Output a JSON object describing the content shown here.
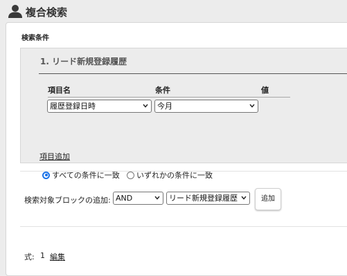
{
  "header": {
    "title": "複合検索",
    "icon": "person-icon"
  },
  "panel": {
    "label": "検索条件"
  },
  "block": {
    "title": "1. リード新規登録履歴",
    "columns": {
      "item": "項目名",
      "condition": "条件",
      "value": "値"
    },
    "row": {
      "item_select": "履歴登録日時",
      "condition_select": "今月"
    },
    "add_item_link": "項目追加",
    "match_options": {
      "all": "すべての条件に一致",
      "any": "いずれかの条件に一致",
      "selected": "all"
    }
  },
  "block_add": {
    "label": "検索対象ブロックの追加:",
    "operator_select": "AND",
    "target_select": "リード新規登録履歴",
    "button": "追加"
  },
  "formula": {
    "label": "式:",
    "value": "1",
    "edit_link": "編集"
  },
  "colors": {
    "accent": "#1a73e8",
    "panel_bg": "#ffffff",
    "block_bg": "#ececec"
  }
}
